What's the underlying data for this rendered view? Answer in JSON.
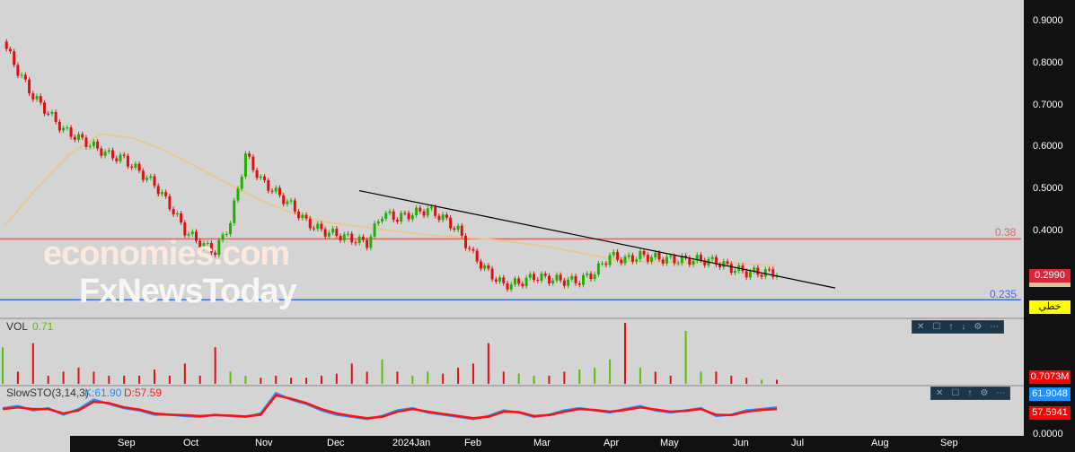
{
  "chart_data": {
    "type": "candlestick",
    "title": "",
    "y_ticks": [
      "0.9000",
      "0.8000",
      "0.7000",
      "0.6000",
      "0.5000",
      "0.4000",
      "0.0000"
    ],
    "ylim": [
      0.23,
      0.9
    ],
    "x_ticks": [
      "Sep",
      "Oct",
      "Nov",
      "Dec",
      "2024Jan",
      "Feb",
      "Mar",
      "Apr",
      "May",
      "Jun",
      "Jul",
      "Aug",
      "Sep"
    ],
    "close": [
      0.85,
      0.78,
      0.72,
      0.68,
      0.64,
      0.62,
      0.6,
      0.58,
      0.57,
      0.54,
      0.51,
      0.46,
      0.4,
      0.37,
      0.35,
      0.42,
      0.58,
      0.52,
      0.49,
      0.46,
      0.42,
      0.4,
      0.39,
      0.38,
      0.37,
      0.44,
      0.43,
      0.44,
      0.45,
      0.43,
      0.4,
      0.34,
      0.3,
      0.27,
      0.275,
      0.29,
      0.285,
      0.28,
      0.28,
      0.3,
      0.34,
      0.33,
      0.34,
      0.335,
      0.33,
      0.33,
      0.33,
      0.325,
      0.31,
      0.3,
      0.3,
      0.299
    ],
    "moving_average": [
      0.41,
      0.5,
      0.58,
      0.63,
      0.62,
      0.59,
      0.55,
      0.51,
      0.47,
      0.44,
      0.42,
      0.41,
      0.4,
      0.39,
      0.385,
      0.38,
      0.37,
      0.36,
      0.345,
      0.33,
      0.325,
      0.325,
      0.325,
      0.32,
      0.317
    ],
    "trendline": [
      0.495,
      0.263
    ],
    "levels": [
      {
        "label": "0.38",
        "value": 0.38,
        "color": "#e06666"
      },
      {
        "label": "0.235",
        "value": 0.235,
        "color": "#3a6fe0"
      }
    ],
    "last_price": "0.2990",
    "ma_value": "0.3170",
    "line_badge": "خطي",
    "volume": {
      "label": "VOL",
      "value": "0.71",
      "axis": "0.7073M",
      "values": [
        0.9,
        0.3,
        1.0,
        0.2,
        0.3,
        0.4,
        0.3,
        0.2,
        0.2,
        0.2,
        0.35,
        0.2,
        0.5,
        0.2,
        0.9,
        0.3,
        0.2,
        0.15,
        0.2,
        0.15,
        0.15,
        0.2,
        0.25,
        0.5,
        0.3,
        0.6,
        0.3,
        0.2,
        0.3,
        0.25,
        0.4,
        0.5,
        1.0,
        0.3,
        0.25,
        0.2,
        0.2,
        0.3,
        0.35,
        0.4,
        0.6,
        1.5,
        0.4,
        0.3,
        0.2,
        1.3,
        0.3,
        0.3,
        0.2,
        0.15,
        0.1,
        0.1
      ]
    },
    "stoch": {
      "label": "SlowSTO(3,14,3)",
      "k_label": "K:61.90",
      "d_label": "D:57.59",
      "k_axis": "61.9048",
      "d_axis": "57.5941",
      "k": [
        60,
        65,
        55,
        60,
        45,
        58,
        80,
        70,
        60,
        55,
        45,
        45,
        42,
        40,
        45,
        42,
        40,
        48,
        95,
        80,
        70,
        55,
        45,
        40,
        35,
        42,
        55,
        60,
        50,
        45,
        40,
        35,
        42,
        55,
        50,
        40,
        45,
        55,
        60,
        55,
        50,
        58,
        65,
        55,
        50,
        55,
        60,
        42,
        45,
        55,
        58,
        62
      ],
      "d": [
        58,
        62,
        58,
        58,
        48,
        55,
        75,
        72,
        62,
        57,
        48,
        45,
        44,
        42,
        44,
        43,
        41,
        45,
        90,
        82,
        72,
        58,
        48,
        42,
        37,
        40,
        52,
        58,
        52,
        47,
        42,
        37,
        40,
        52,
        51,
        42,
        44,
        52,
        58,
        56,
        52,
        56,
        62,
        57,
        52,
        54,
        58,
        45,
        44,
        52,
        56,
        58
      ]
    }
  },
  "watermark": {
    "line1": "economies.com",
    "line2": "FxNewsToday"
  }
}
